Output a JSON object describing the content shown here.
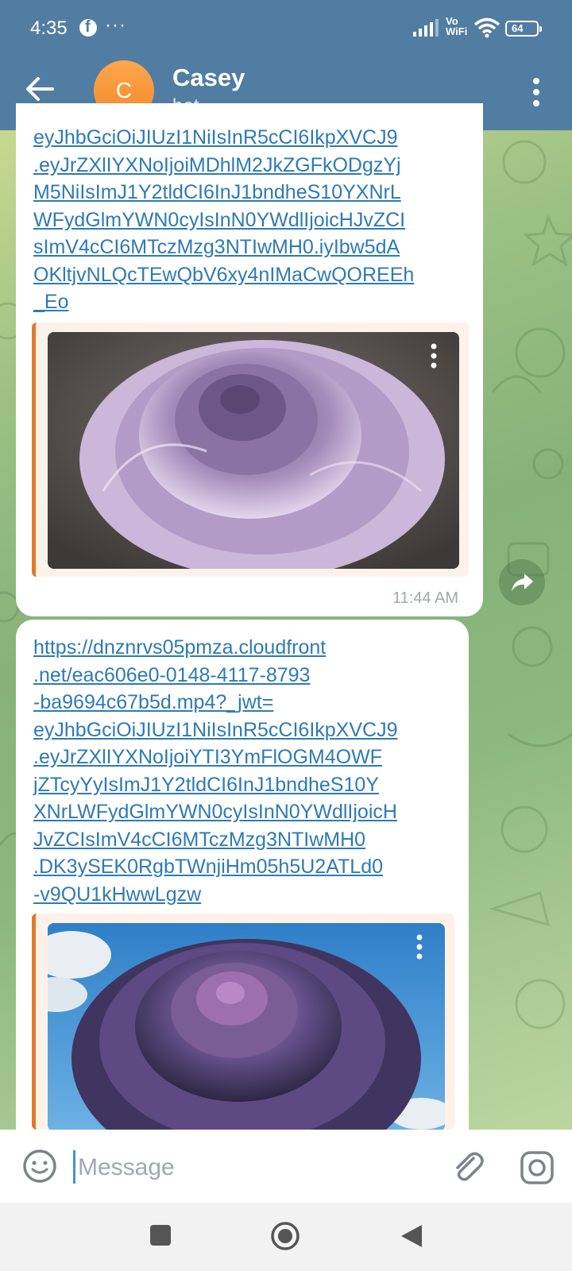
{
  "status_bar": {
    "time": "4:35",
    "dots": "···",
    "vo": "Vo",
    "wifi": "WiFi",
    "battery": "64"
  },
  "header": {
    "avatar_letter": "C",
    "title": "Casey",
    "subtitle": "bot",
    "background_color": "#517da2"
  },
  "messages": [
    {
      "link_text": "eyJhbGciOiJIUzI1NiIsInR5cCI6IkpXVCJ9\n.eyJrZXlIYXNoIjoiMDhlM2JkZGFkODgzYj\nM5NiIsImJ1Y2tldCI6InJ1bndheS10YXNrL\nWFydGlmYWN0cyIsInN0YWdlIjoicHJvZCI\nsImV4cCI6MTczMzg3NTIwMH0.iyIbw5dA\nOKltjvNLQcTEwQbV6xy4nIMaCwQOREEh\n_Eo",
      "timestamp": "11:44 AM",
      "image": "purple-rose-image"
    },
    {
      "link_text": "https://dnznrvs05pmza.cloudfront\n.net/eac606e0-0148-4117-8793\n-ba9694c67b5d.mp4?_jwt=\neyJhbGciOiJIUzI1NiIsInR5cCI6IkpXVCJ9\n.eyJrZXlIYXNoIjoiYTI3YmFlOGM4OWF\njZTcyYyIsImJ1Y2tldCI6InJ1bndheS10Y\nXNrLWFydGlmYWN0cyIsInN0YWdlIjoicH\nJvZCIsImV4cCI6MTczMzg3NTIwMH0\n.DK3ySEK0RgbTWnjiHm05h5U2ATLd0\n-v9QU1kHwwLgzw",
      "image": "purple-rose-sky-image"
    }
  ],
  "input": {
    "placeholder": "Message"
  },
  "colors": {
    "link": "#2e7ab6",
    "preview_accent": "#e0792b",
    "avatar": "#f39233"
  }
}
